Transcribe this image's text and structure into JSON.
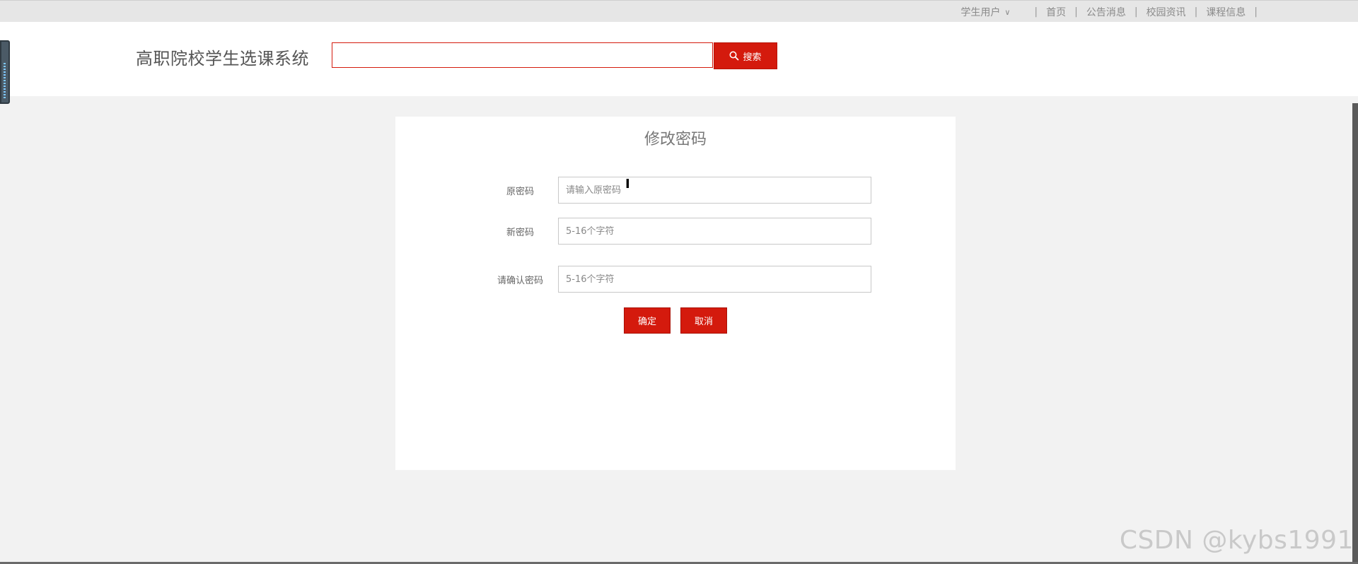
{
  "topbar": {
    "user_label": "学生用户",
    "nav": [
      "首页",
      "公告消息",
      "校园资讯",
      "课程信息"
    ]
  },
  "header": {
    "site_title": "高职院校学生选课系统",
    "search": {
      "value": "",
      "placeholder": "",
      "button_label": "搜索"
    }
  },
  "panel": {
    "title": "修改密码",
    "fields": [
      {
        "label": "原密码",
        "placeholder": "请输入原密码",
        "value": ""
      },
      {
        "label": "新密码",
        "placeholder": "5-16个字符",
        "value": ""
      },
      {
        "label": "请确认密码",
        "placeholder": "5-16个字符",
        "value": ""
      }
    ],
    "confirm_label": "确定",
    "cancel_label": "取消"
  },
  "watermark": "CSDN @kybs1991",
  "colors": {
    "accent": "#d41a0d",
    "background": "#f2f2f2",
    "topbar": "#e6e6e6"
  }
}
